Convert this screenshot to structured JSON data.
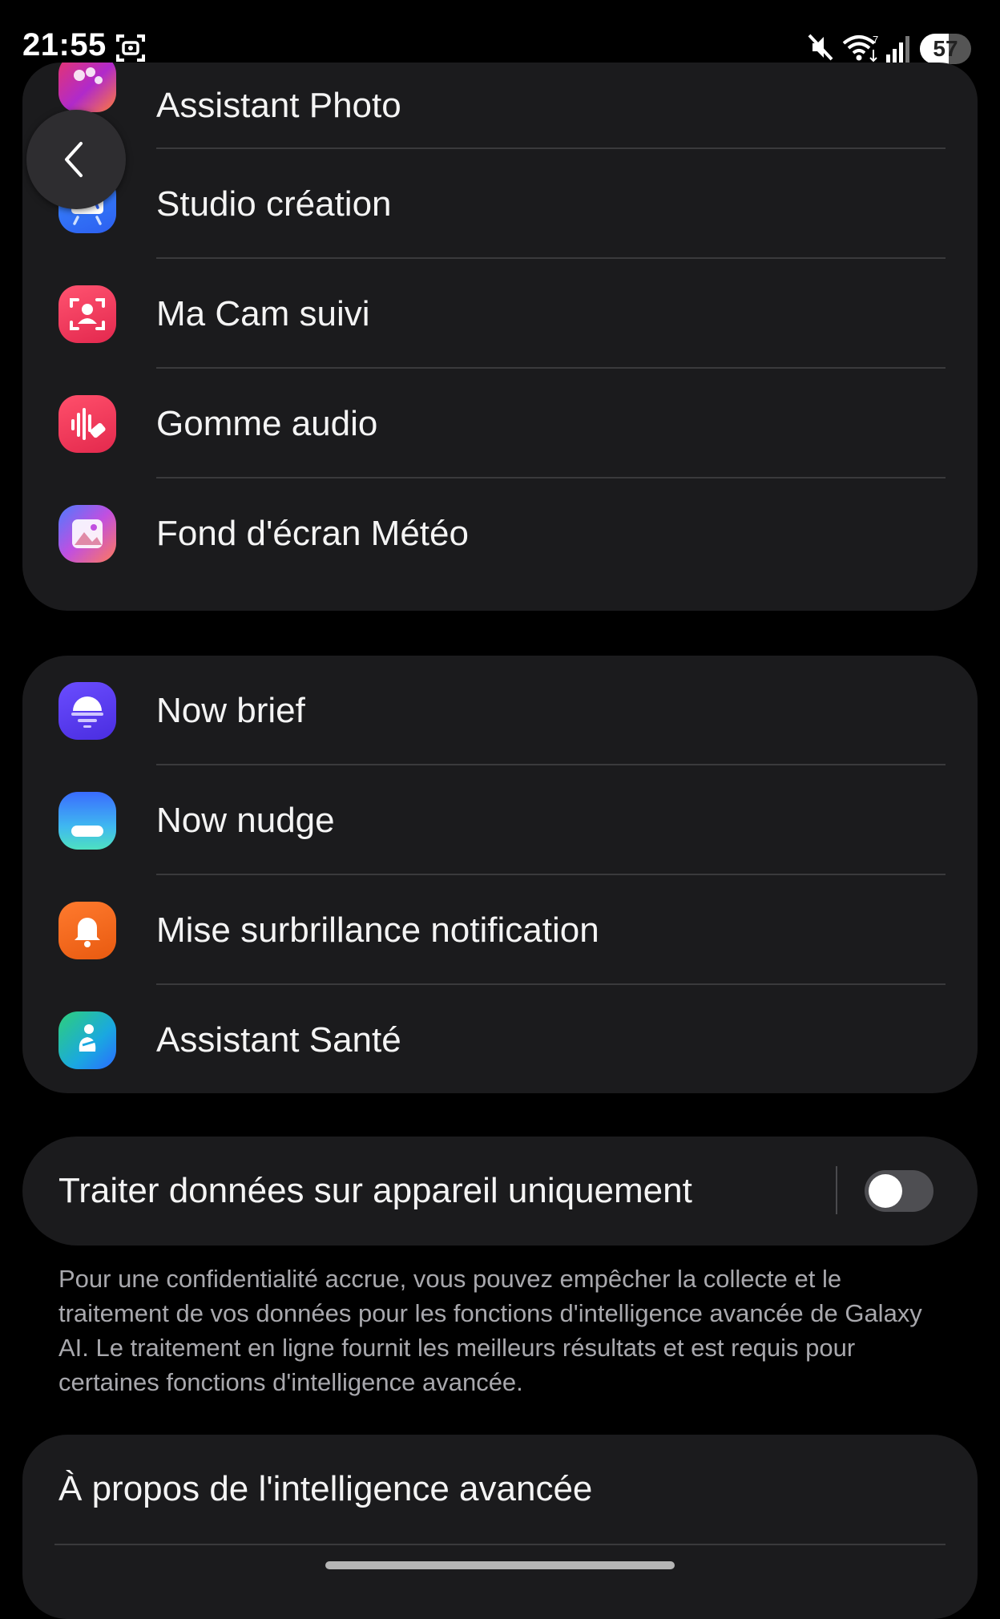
{
  "status_bar": {
    "time": "21:55",
    "battery_level": "57",
    "battery_fraction": 0.57
  },
  "group1": {
    "items": [
      {
        "label": "Assistant Photo",
        "icon": "photo-assist-icon"
      },
      {
        "label": "Studio création",
        "icon": "sketch-studio-icon"
      },
      {
        "label": "Ma Cam suivi",
        "icon": "auto-framing-camera-icon"
      },
      {
        "label": "Gomme audio",
        "icon": "audio-eraser-icon"
      },
      {
        "label": "Fond d'écran Météo",
        "icon": "weather-wallpaper-icon"
      }
    ]
  },
  "group2": {
    "items": [
      {
        "label": "Now brief",
        "icon": "now-brief-icon"
      },
      {
        "label": "Now nudge",
        "icon": "now-nudge-icon"
      },
      {
        "label": "Mise surbrillance notification",
        "icon": "notification-bell-icon"
      },
      {
        "label": "Assistant Santé",
        "icon": "health-assistant-icon"
      }
    ]
  },
  "process_on_device": {
    "label": "Traiter données sur appareil uniquement",
    "enabled": false,
    "description": "Pour une confidentialité accrue, vous pouvez empêcher la collecte et le traitement de vos données pour les fonctions d'intelligence avancée de Galaxy AI. Le traitement en ligne fournit les meilleurs résultats et est requis pour certaines fonctions d'intelligence avancée."
  },
  "about": {
    "label": "À propos de l'intelligence avancée"
  }
}
